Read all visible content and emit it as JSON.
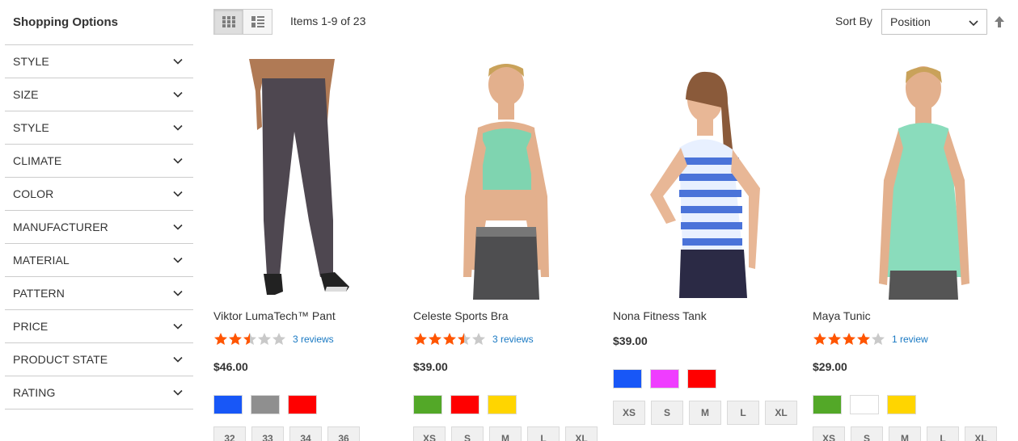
{
  "sidebar": {
    "title": "Shopping Options",
    "filters": [
      "Style",
      "Size",
      "Style",
      "Climate",
      "Color",
      "Manufacturer",
      "Material",
      "Pattern",
      "Price",
      "Product State",
      "Rating"
    ]
  },
  "toolbar": {
    "amount": "Items 1-9 of 23",
    "sort_label": "Sort By",
    "sort_value": "Position"
  },
  "colors": {
    "star_filled": "#ff5501",
    "star_empty": "#c9c9c9",
    "link": "#1979c3"
  },
  "products": [
    {
      "name": "Viktor LumaTech™ Pant",
      "rating": 2.5,
      "reviews": "3 reviews",
      "price": "$46.00",
      "swatches": [
        "#1857f7",
        "#8f8f8f",
        "#ff0000"
      ],
      "sizes": [
        "32",
        "33",
        "34",
        "36"
      ]
    },
    {
      "name": "Celeste Sports Bra",
      "rating": 3.5,
      "reviews": "3 reviews",
      "price": "$39.00",
      "swatches": [
        "#53a828",
        "#ff0000",
        "#ffd500"
      ],
      "sizes": [
        "XS",
        "S",
        "M",
        "L",
        "XL"
      ]
    },
    {
      "name": "Nona Fitness Tank",
      "rating": 0,
      "reviews": "",
      "price": "$39.00",
      "swatches": [
        "#1857f7",
        "#ef3dff",
        "#ff0000"
      ],
      "sizes": [
        "XS",
        "S",
        "M",
        "L",
        "XL"
      ]
    },
    {
      "name": "Maya Tunic",
      "rating": 4,
      "reviews": "1 review",
      "price": "$29.00",
      "swatches": [
        "#53a828",
        "#ffffff",
        "#ffd500"
      ],
      "sizes": [
        "XS",
        "S",
        "M",
        "L",
        "XL"
      ]
    }
  ]
}
